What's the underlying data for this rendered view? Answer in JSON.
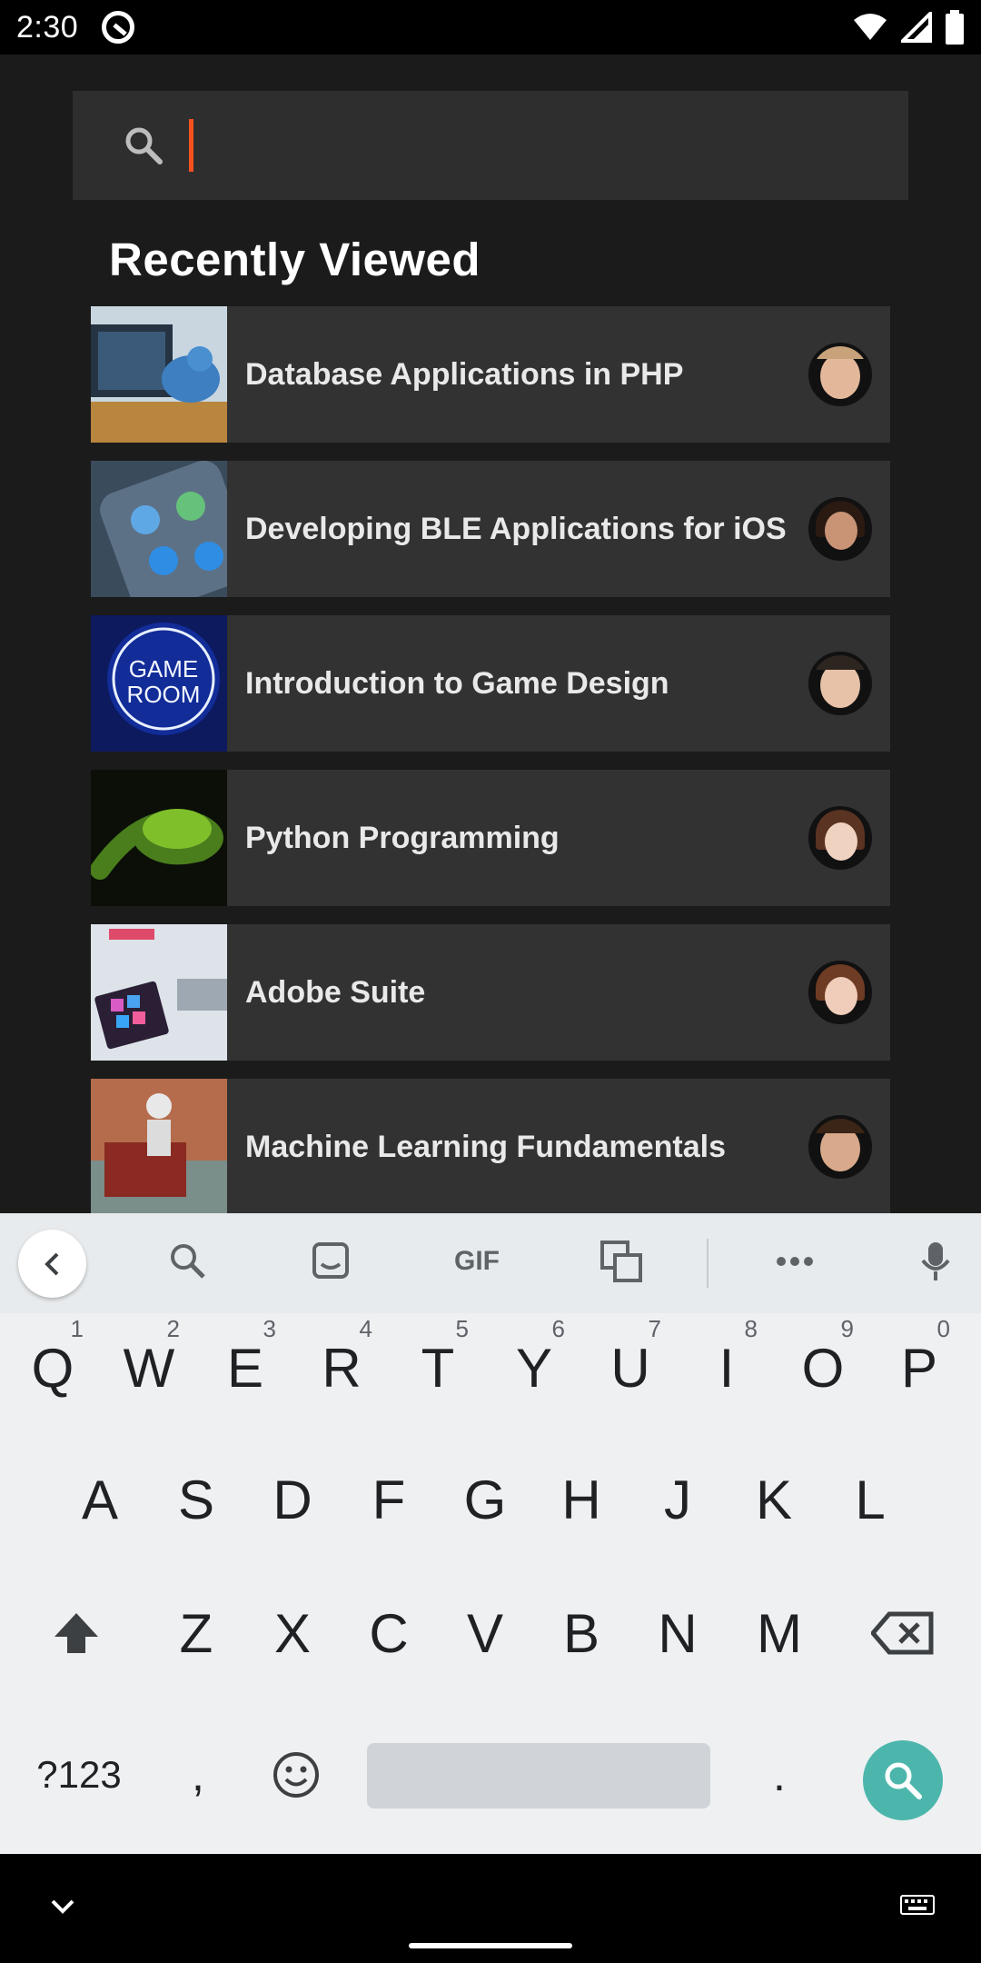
{
  "status_bar": {
    "time": "2:30"
  },
  "search": {
    "value": "",
    "placeholder": ""
  },
  "section_title": "Recently Viewed",
  "courses": [
    {
      "title": "Database Applications in PHP"
    },
    {
      "title": "Developing BLE Applications for iOS"
    },
    {
      "title": "Introduction to Game Design"
    },
    {
      "title": "Python Programming"
    },
    {
      "title": "Adobe Suite"
    },
    {
      "title": "Machine Learning Fundamentals"
    }
  ],
  "keyboard": {
    "toolbar": [
      "search-icon",
      "sticker-icon",
      "GIF",
      "translate-icon",
      "more-icon",
      "mic-icon"
    ],
    "row1": [
      {
        "key": "Q",
        "hint": "1"
      },
      {
        "key": "W",
        "hint": "2"
      },
      {
        "key": "E",
        "hint": "3"
      },
      {
        "key": "R",
        "hint": "4"
      },
      {
        "key": "T",
        "hint": "5"
      },
      {
        "key": "Y",
        "hint": "6"
      },
      {
        "key": "U",
        "hint": "7"
      },
      {
        "key": "I",
        "hint": "8"
      },
      {
        "key": "O",
        "hint": "9"
      },
      {
        "key": "P",
        "hint": "0"
      }
    ],
    "row2": [
      "A",
      "S",
      "D",
      "F",
      "G",
      "H",
      "J",
      "K",
      "L"
    ],
    "row3": [
      "Z",
      "X",
      "C",
      "V",
      "B",
      "N",
      "M"
    ],
    "symbols_key": "?123",
    "comma_key": ",",
    "period_key": ".",
    "accent_color": "#4db6ac"
  }
}
